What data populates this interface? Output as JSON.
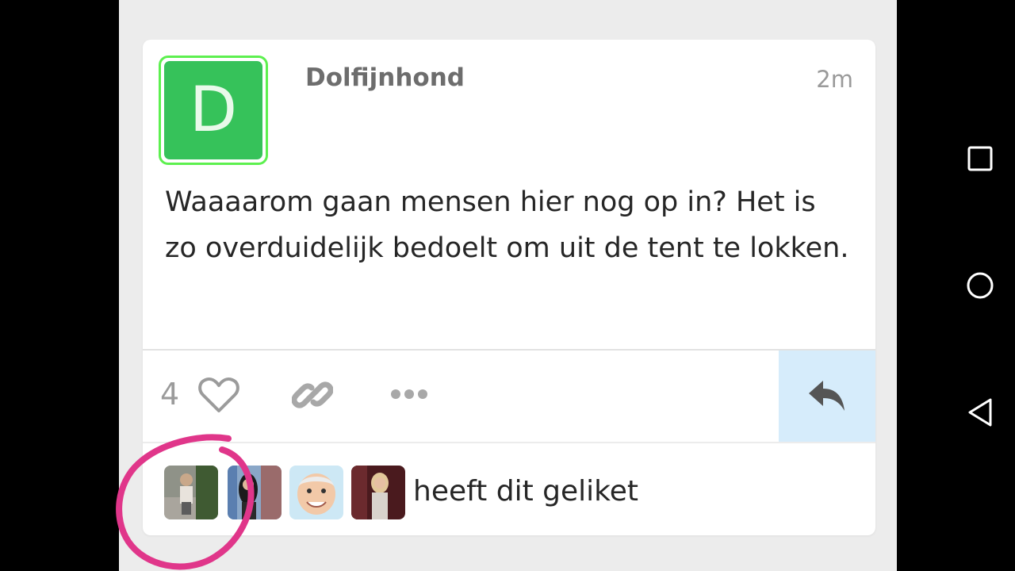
{
  "post": {
    "avatar_letter": "D",
    "username": "Dolfijnhond",
    "timestamp": "2m",
    "text": "Waaaarom gaan mensen hier nog op in? Het is zo overduidelijk bedoelt om uit de tent te lokken."
  },
  "actions": {
    "like_count": "4",
    "icons": [
      "heart-icon",
      "link-icon",
      "more-icon",
      "reply-icon"
    ]
  },
  "likers": {
    "text": "heeft dit geliket",
    "count": 4
  },
  "colors": {
    "avatar_bg": "#36c25a",
    "avatar_border": "#5df04f",
    "reply_bg": "#d6ecfb",
    "annotation": "#e0368a"
  },
  "navbar": {
    "icons": [
      "recents-icon",
      "home-icon",
      "back-icon"
    ]
  }
}
